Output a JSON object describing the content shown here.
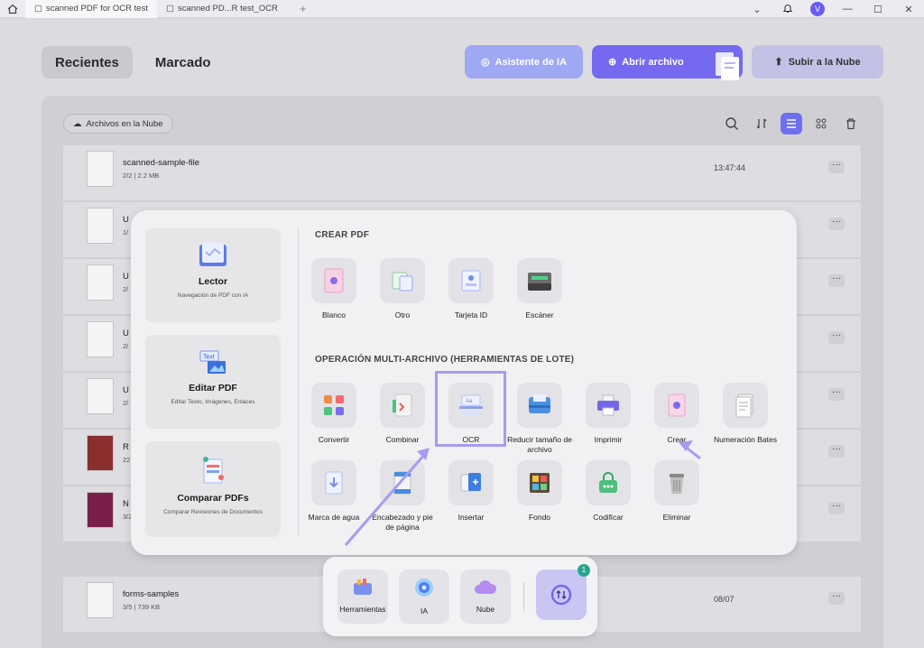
{
  "titlebar": {
    "tabs": [
      {
        "label": "scanned PDF for OCR test"
      },
      {
        "label": "scanned PD...R test_OCR"
      }
    ],
    "avatar_initial": "V"
  },
  "nav": {
    "segments": [
      {
        "label": "Recientes"
      },
      {
        "label": "Marcado"
      }
    ],
    "ai_button": "Asistente de IA",
    "open_button": "Abrir archivo",
    "cloud_button": "Subir a la Nube"
  },
  "files_panel": {
    "cloud_filter": "Archivos en la Nube",
    "rows": [
      {
        "name": "scanned-sample-file",
        "meta": "2/2 | 2.2 MB",
        "date": "13:47:44"
      },
      {
        "name": "U",
        "meta": "1/",
        "date": ""
      },
      {
        "name": "U",
        "meta": "2/",
        "date": ""
      },
      {
        "name": "U",
        "meta": "2/",
        "date": ""
      },
      {
        "name": "U",
        "meta": "2/",
        "date": ""
      },
      {
        "name": "R",
        "meta": "22",
        "date": ""
      },
      {
        "name": "N",
        "meta": "3/27",
        "date": ""
      },
      {
        "name": "forms-samples",
        "meta": "3/5 | 739 KB",
        "date": "08/07"
      }
    ]
  },
  "tools_popup": {
    "cards": [
      {
        "title": "Lector",
        "subtitle": "Navegación de PDF con IA"
      },
      {
        "title": "Editar PDF",
        "subtitle": "Editar Texto, Imágenes, Enlaces"
      },
      {
        "title": "Comparar PDFs",
        "subtitle": "Comparar Revisiones de Documentos"
      }
    ],
    "create_section": {
      "title": "CREAR PDF",
      "items": [
        {
          "label": "Blanco"
        },
        {
          "label": "Otro"
        },
        {
          "label": "Tarjeta ID"
        },
        {
          "label": "Escáner"
        }
      ]
    },
    "batch_section": {
      "title": "OPERACIÓN MULTI-ARCHIVO (HERRAMIENTAS DE LOTE)",
      "items": [
        {
          "label": "Convertir"
        },
        {
          "label": "Combinar"
        },
        {
          "label": "OCR"
        },
        {
          "label": "Reducir tamaño de archivo"
        },
        {
          "label": "Imprimir"
        },
        {
          "label": "Crear"
        },
        {
          "label": "Numeración Bates"
        },
        {
          "label": "Marca de agua"
        },
        {
          "label": "Encabezado y pie de página"
        },
        {
          "label": "Insertar"
        },
        {
          "label": "Fondo"
        },
        {
          "label": "Codificar"
        },
        {
          "label": "Eliminar"
        }
      ]
    }
  },
  "dock": {
    "items": [
      {
        "label": "Herramientas"
      },
      {
        "label": "IA"
      },
      {
        "label": "Nube"
      }
    ],
    "sync_badge": "1"
  },
  "colors": {
    "accent": "#7469ef",
    "highlight": "#a79bf0",
    "badge": "#2aa58d"
  }
}
